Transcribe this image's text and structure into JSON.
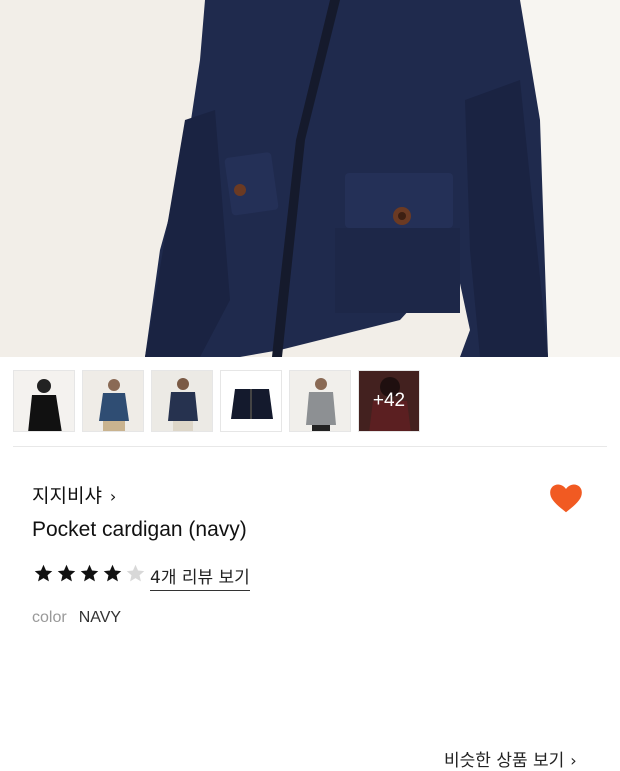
{
  "hero": {
    "image_alt": "navy pocket cardigan worn by model"
  },
  "thumbnails": {
    "items": [
      {
        "name": "thumb-1"
      },
      {
        "name": "thumb-2"
      },
      {
        "name": "thumb-3"
      },
      {
        "name": "thumb-4"
      },
      {
        "name": "thumb-5"
      }
    ],
    "more_label": "+42",
    "similar_label": "비슷한 상품 보기",
    "similar_chevron": "›"
  },
  "product": {
    "brand": "지지비샤",
    "brand_chevron": "›",
    "title": "Pocket cardigan (navy)",
    "rating": 4,
    "rating_max": 5,
    "review_link": "4개 리뷰 보기",
    "option_label": "color",
    "option_value": "NAVY"
  },
  "colors": {
    "accent": "#f15a22",
    "star": "#111111",
    "star_empty": "#d8d8d8"
  }
}
